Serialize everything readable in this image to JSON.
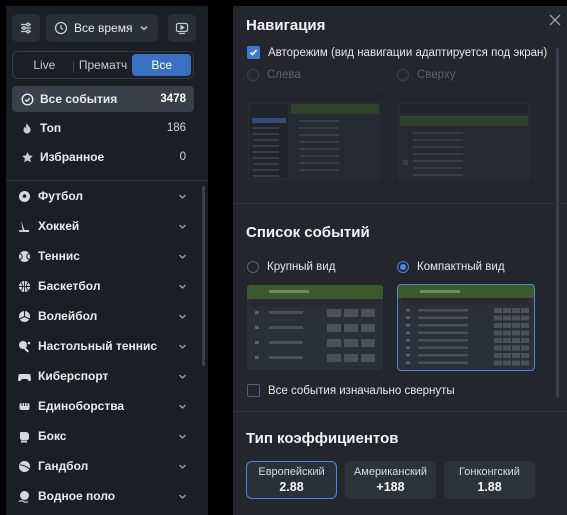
{
  "sidebar": {
    "time_filter": "Все время",
    "tabs": [
      {
        "label": "Live",
        "active": false
      },
      {
        "label": "Прематч",
        "active": false
      },
      {
        "label": "Все",
        "active": true
      }
    ],
    "quick": [
      {
        "label": "Все события",
        "count": "3478",
        "icon": "list-icon",
        "selected": true
      },
      {
        "label": "Топ",
        "count": "186",
        "icon": "fire-icon",
        "selected": false
      },
      {
        "label": "Избранное",
        "count": "0",
        "icon": "star-icon",
        "selected": false
      }
    ],
    "sports": [
      {
        "label": "Футбол",
        "icon": "football-icon"
      },
      {
        "label": "Хоккей",
        "icon": "hockey-icon"
      },
      {
        "label": "Теннис",
        "icon": "tennis-icon"
      },
      {
        "label": "Баскетбол",
        "icon": "basketball-icon"
      },
      {
        "label": "Волейбол",
        "icon": "volleyball-icon"
      },
      {
        "label": "Настольный теннис",
        "icon": "table-tennis-icon"
      },
      {
        "label": "Киберспорт",
        "icon": "gamepad-icon"
      },
      {
        "label": "Единоборства",
        "icon": "fist-icon"
      },
      {
        "label": "Бокс",
        "icon": "boxing-glove-icon"
      },
      {
        "label": "Гандбол",
        "icon": "handball-icon"
      },
      {
        "label": "Водное поло",
        "icon": "water-polo-icon"
      }
    ]
  },
  "settings": {
    "navigation": {
      "title": "Навигация",
      "auto_mode": {
        "label": "Авторежим (вид навигации адаптируется под экран)",
        "checked": true
      },
      "options": [
        {
          "label": "Слева",
          "selected": false,
          "disabled": true
        },
        {
          "label": "Сверху",
          "selected": false,
          "disabled": true
        }
      ]
    },
    "event_list": {
      "title": "Список событий",
      "options": [
        {
          "label": "Крупный вид",
          "selected": false
        },
        {
          "label": "Компактный вид",
          "selected": true
        }
      ],
      "collapse_all": {
        "label": "Все события изначально свернуты",
        "checked": false
      }
    },
    "odds": {
      "title": "Тип коэффициентов",
      "formats": [
        {
          "label": "Европейский",
          "value": "2.88",
          "selected": true
        },
        {
          "label": "Американский",
          "value": "+188",
          "selected": false
        },
        {
          "label": "Гонконгский",
          "value": "1.88",
          "selected": false
        }
      ]
    }
  },
  "colors": {
    "accent": "#3970c2",
    "preview_header_green": "#3a5a2c"
  }
}
